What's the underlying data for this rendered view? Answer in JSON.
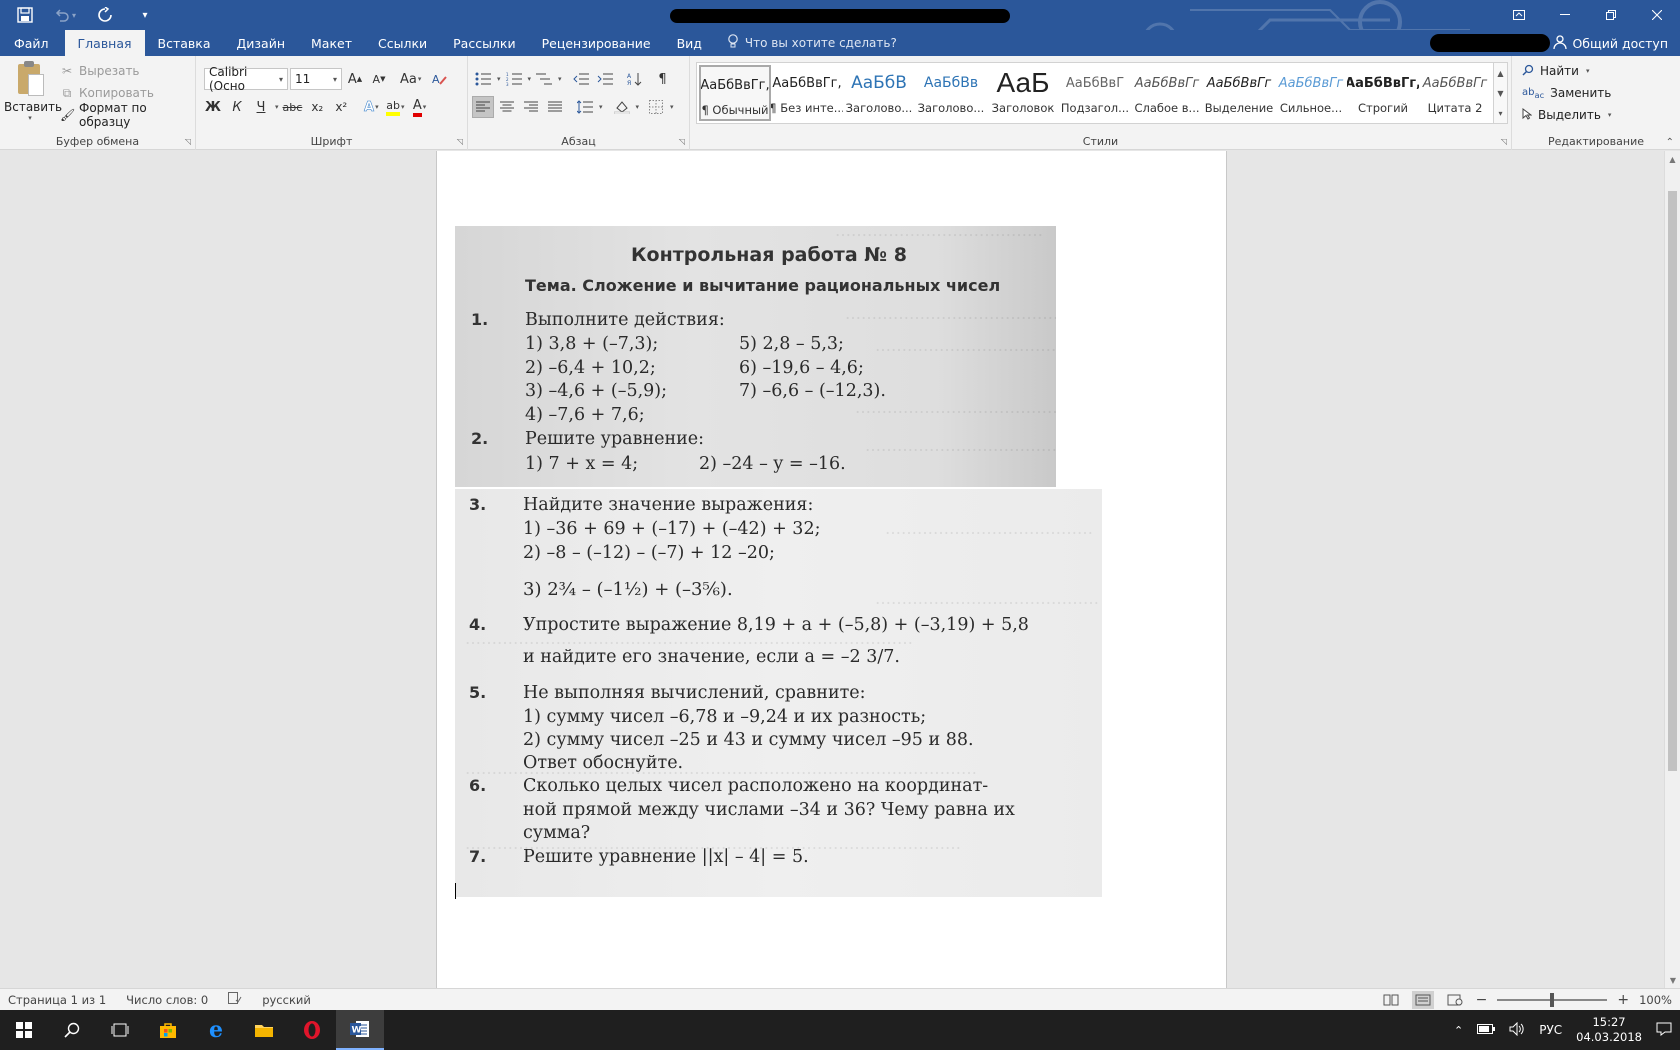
{
  "qat": {
    "undo_arrow": "▾",
    "customize": "▾"
  },
  "tabs": {
    "file": "Файл",
    "items": [
      "Главная",
      "Вставка",
      "Дизайн",
      "Макет",
      "Ссылки",
      "Рассылки",
      "Рецензирование",
      "Вид"
    ],
    "tell_me": "Что вы хотите сделать?",
    "share": "Общий доступ"
  },
  "clipboard": {
    "paste": "Вставить",
    "cut": "Вырезать",
    "copy": "Копировать",
    "format_painter": "Формат по образцу",
    "label": "Буфер обмена"
  },
  "font": {
    "family": "Calibri (Осно",
    "size": "11",
    "grow": "A",
    "shrink": "A",
    "case": "Aa",
    "bold": "Ж",
    "italic": "К",
    "underline": "Ч",
    "strike": "abc",
    "sub": "x₂",
    "sup": "x²",
    "effects": "A",
    "highlight": "ab",
    "color": "A",
    "label": "Шрифт"
  },
  "paragraph": {
    "label": "Абзац"
  },
  "styles": {
    "label": "Стили",
    "items": [
      {
        "sample": "АаБбВвГг,",
        "name": "¶ Обычный"
      },
      {
        "sample": "АаБбВвГг,",
        "name": "¶ Без инте..."
      },
      {
        "sample": "АаБбВ",
        "name": "Заголово..."
      },
      {
        "sample": "АаБбВв",
        "name": "Заголово..."
      },
      {
        "sample": "АаБ",
        "name": "Заголовок"
      },
      {
        "sample": "АаБбВвГ",
        "name": "Подзагол..."
      },
      {
        "sample": "АаБбВвГг",
        "name": "Слабое в..."
      },
      {
        "sample": "АаБбВвГг",
        "name": "Выделение"
      },
      {
        "sample": "АаБбВвГг",
        "name": "Сильное..."
      },
      {
        "sample": "АаБбВвГг,",
        "name": "Строгий"
      },
      {
        "sample": "АаБбВвГг",
        "name": "Цитата 2"
      }
    ]
  },
  "editing": {
    "find": "Найти",
    "replace": "Заменить",
    "select": "Выделить",
    "label": "Редактирование"
  },
  "document": {
    "title": "Контрольная работа № 8",
    "topic": "Тема. Сложение и вычитание рациональных чисел",
    "lines": [
      {
        "num": "1.",
        "text": "Выполните действия:"
      },
      {
        "num": "",
        "text": "1) 3,8 + (–7,3);"
      },
      {
        "num": "",
        "text": "5) 2,8 – 5,3;"
      },
      {
        "num": "",
        "text": "2) –6,4 + 10,2;"
      },
      {
        "num": "",
        "text": "6) –19,6 – 4,6;"
      },
      {
        "num": "",
        "text": "3) –4,6 + (–5,9);"
      },
      {
        "num": "",
        "text": "7) –6,6 – (–12,3)."
      },
      {
        "num": "",
        "text": "4) –7,6 + 7,6;"
      },
      {
        "num": "2.",
        "text": "Решите уравнение:"
      },
      {
        "num": "",
        "text": "1) 7 + x = 4;"
      },
      {
        "num": "",
        "text": "2) –24 – y = –16."
      },
      {
        "num": "3.",
        "text": "Найдите значение выражения:"
      },
      {
        "num": "",
        "text": "1) –36 + 69 + (–17) + (–42) + 32;"
      },
      {
        "num": "",
        "text": "2) –8 – (–12) – (–7) + 12 –20;"
      },
      {
        "num": "",
        "text": "3) 2¾ – (–1½) + (–3⅚)."
      },
      {
        "num": "4.",
        "text": "Упростите выражение 8,19 + a + (–5,8) + (–3,19) + 5,8"
      },
      {
        "num": "",
        "text": "и найдите его значение, если a = –2 3/7."
      },
      {
        "num": "5.",
        "text": "Не выполняя вычислений, сравните:"
      },
      {
        "num": "",
        "text": "1) сумму чисел –6,78 и –9,24 и их разность;"
      },
      {
        "num": "",
        "text": "2) сумму чисел –25 и 43 и сумму чисел –95 и 88."
      },
      {
        "num": "",
        "text": "Ответ обоснуйте."
      },
      {
        "num": "6.",
        "text": "Сколько целых чисел расположено на координат-"
      },
      {
        "num": "",
        "text": "ной прямой между числами –34 и 36? Чему равна их"
      },
      {
        "num": "",
        "text": "сумма?"
      },
      {
        "num": "7.",
        "text": "Решите уравнение ||x| – 4| = 5."
      }
    ]
  },
  "status": {
    "page": "Страница 1 из 1",
    "words": "Число слов: 0",
    "language": "русский",
    "zoom": "100%"
  },
  "tray": {
    "lang": "РУС",
    "time": "15:27",
    "date": "04.03.2018"
  },
  "colors": {
    "accent": "#2b579a"
  }
}
